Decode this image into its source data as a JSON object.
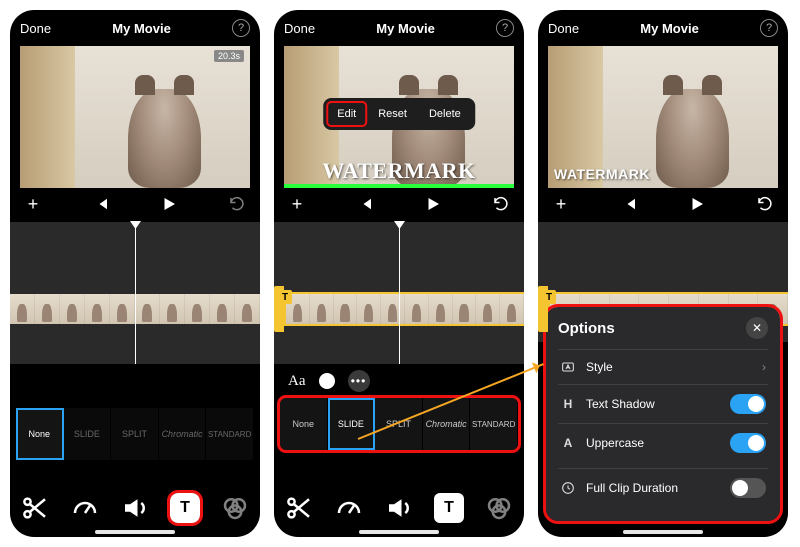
{
  "header": {
    "done": "Done",
    "title": "My Movie",
    "help": "?"
  },
  "preview": {
    "duration_badge": "20.3s",
    "watermark": "WATERMARK"
  },
  "context_menu": {
    "edit": "Edit",
    "reset": "Reset",
    "delete": "Delete"
  },
  "transport": {
    "plus": "+",
    "undo": "↷"
  },
  "text_styles_row": {
    "aa": "Aa",
    "more": "•••"
  },
  "text_styles": [
    "None",
    "SLIDE",
    "SPLIT",
    "Chromatic",
    "STANDARD"
  ],
  "selected_style": {
    "phone1": 0,
    "phone2": 1
  },
  "timeline_chip": "T",
  "options_panel": {
    "title": "Options",
    "items": [
      {
        "icon": "text-style-icon",
        "label": "Style",
        "type": "link"
      },
      {
        "icon": "shadow-icon",
        "label": "Text Shadow",
        "type": "toggle",
        "value": true
      },
      {
        "icon": "uppercase-icon",
        "label": "Uppercase",
        "type": "toggle",
        "value": true
      },
      {
        "icon": "clock-icon",
        "label": "Full Clip Duration",
        "type": "toggle",
        "value": false
      }
    ]
  },
  "toolbar_icons": [
    "scissors-icon",
    "speedometer-icon",
    "volume-icon",
    "text-icon",
    "filters-icon"
  ],
  "colors": {
    "accent": "#2aa3f5",
    "highlight": "#e11",
    "timeline_sel": "#f5c431"
  }
}
